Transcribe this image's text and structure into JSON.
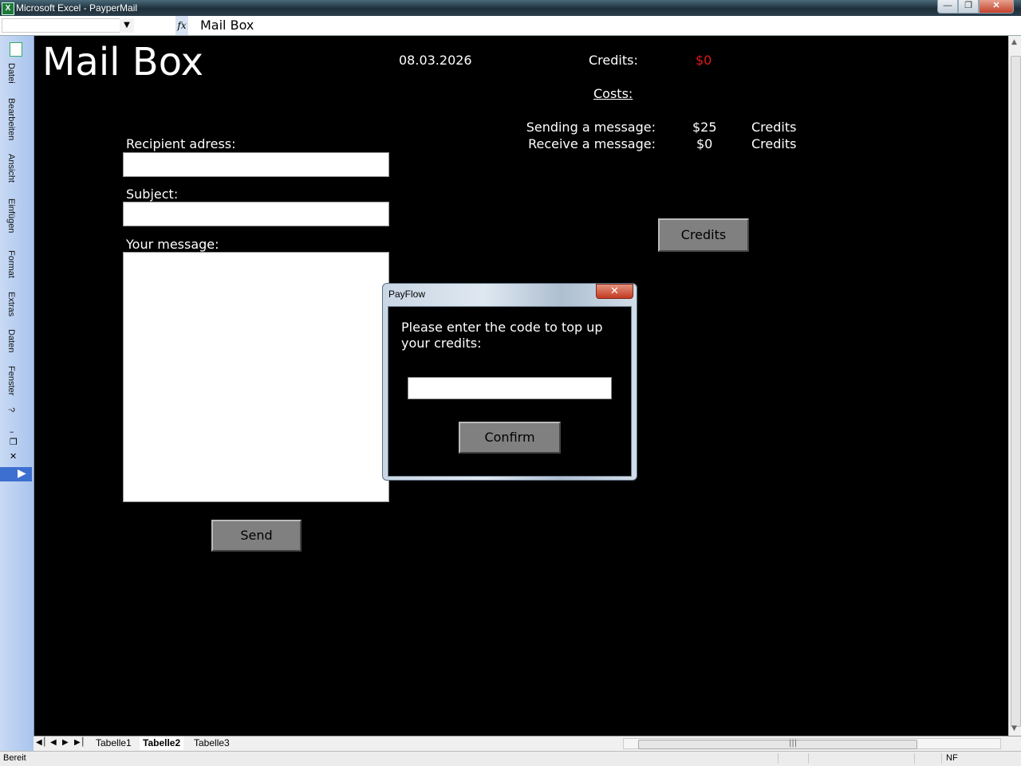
{
  "window": {
    "title": "Microsoft Excel - PayperMail",
    "app_icon_letter": "X",
    "minimize_icon": "minimize-icon",
    "restore_icon": "restore-icon",
    "close_icon": "close-icon"
  },
  "formula_bar": {
    "name_box": "",
    "fx_label": "fx",
    "content": "Mail Box"
  },
  "left_menu": {
    "items": [
      "Datei",
      "Bearbeiten",
      "Ansicht",
      "Einfügen",
      "Format",
      "Extras",
      "Daten",
      "Fenster",
      "?"
    ]
  },
  "sheet": {
    "title": "Mail Box",
    "date": "08.03.2026",
    "credits_label": "Credits:",
    "credits_value": "$0",
    "credits_value_color": "#e01a1a",
    "costs_label": "Costs:",
    "costs": [
      {
        "label": "Sending a message:",
        "value": "$25",
        "unit": "Credits"
      },
      {
        "label": "Receive a message:",
        "value": "$0",
        "unit": "Credits"
      }
    ],
    "recipient_label": "Recipient adress:",
    "recipient_value": "",
    "subject_label": "Subject:",
    "subject_value": "",
    "message_label": "Your message:",
    "message_value": "",
    "send_button": "Send",
    "credits_button": "Credits"
  },
  "dialog": {
    "title": "PayFlow",
    "close_glyph": "x",
    "prompt": "Please enter the code to top up your credits:",
    "code_value": "",
    "confirm_button": "Confirm"
  },
  "sheet_tabs": {
    "tabs": [
      "Tabelle1",
      "Tabelle2",
      "Tabelle3"
    ],
    "active": "Tabelle2"
  },
  "status_bar": {
    "status": "Bereit",
    "indicator": "NF"
  }
}
